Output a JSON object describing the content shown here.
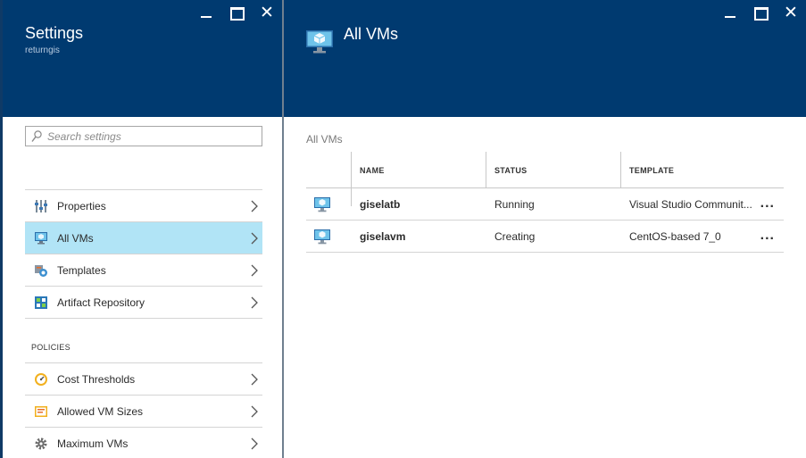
{
  "settings_blade": {
    "title": "Settings",
    "subtitle": "returngis",
    "search": {
      "placeholder": "Search settings",
      "value": ""
    },
    "menu": [
      {
        "label": "Properties",
        "icon": "properties-icon",
        "selected": false
      },
      {
        "label": "All VMs",
        "icon": "vm-icon",
        "selected": true
      },
      {
        "label": "Templates",
        "icon": "templates-icon",
        "selected": false
      },
      {
        "label": "Artifact Repository",
        "icon": "artifact-repository-icon",
        "selected": false
      }
    ],
    "policies_header": "POLICIES",
    "policies": [
      {
        "label": "Cost Thresholds",
        "icon": "cost-thresholds-icon"
      },
      {
        "label": "Allowed VM Sizes",
        "icon": "allowed-vm-sizes-icon"
      },
      {
        "label": "Maximum VMs",
        "icon": "gear-icon"
      }
    ]
  },
  "allvms_blade": {
    "title": "All VMs",
    "content_title": "All VMs",
    "columns": {
      "name": "NAME",
      "status": "STATUS",
      "template": "TEMPLATE"
    },
    "rows": [
      {
        "name": "giselatb",
        "status": "Running",
        "template": "Visual Studio Communit...",
        "more": "..."
      },
      {
        "name": "giselavm",
        "status": "Creating",
        "template": "CentOS-based 7_0",
        "more": "..."
      }
    ]
  },
  "window_controls": {
    "close": "✕"
  },
  "colors": {
    "header": "#003a70",
    "selected_item": "#b1e4f6",
    "accent": "#1e88c8"
  }
}
